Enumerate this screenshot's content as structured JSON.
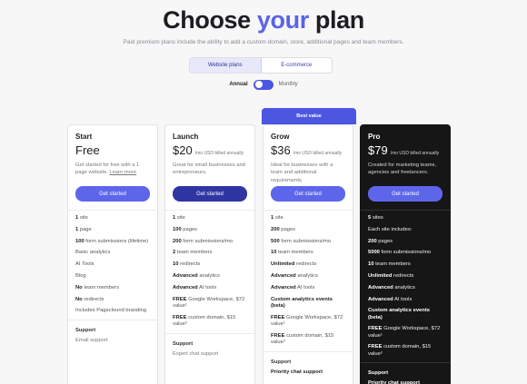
{
  "header": {
    "title_pre": "Choose ",
    "title_accent": "your",
    "title_post": " plan",
    "subtitle": "Paid premium plans include the ability to add a custom domain, store, additional pages and team members."
  },
  "tabs": [
    {
      "label": "Website plans",
      "active": true
    },
    {
      "label": "E-commerce",
      "active": false
    }
  ],
  "billing": {
    "annual_label": "Annual",
    "monthly_label": "Monthly",
    "toggle_on": "annual"
  },
  "best_value_label": "Best value",
  "plans": [
    {
      "name": "Start",
      "price": "Free",
      "price_note": "",
      "desc_text": "Get started for free with a 1 page website.",
      "desc_link": "Learn more",
      "cta": "Get started",
      "features": [
        {
          "b": "1",
          "t": " site"
        },
        {
          "b": "1",
          "t": " page"
        },
        {
          "b": "100",
          "t": " form submissions (lifetime)"
        },
        {
          "b": "",
          "t": "Basic analytics"
        },
        {
          "b": "",
          "t": "AI Tools"
        },
        {
          "b": "",
          "t": "Blog"
        },
        {
          "b": "No",
          "t": " team members"
        },
        {
          "b": "No",
          "t": " redirects"
        },
        {
          "b": "",
          "t": "Includes Pageclound branding"
        }
      ],
      "support_heading": "Support",
      "support_value": "Email support"
    },
    {
      "name": "Launch",
      "price": "$20",
      "price_note": "/mo USD billed annually",
      "desc_text": "Great for small businesses and entrepreneurs.",
      "cta": "Get started",
      "features": [
        {
          "b": "1",
          "t": " site"
        },
        {
          "b": "100",
          "t": " pages"
        },
        {
          "b": "200",
          "t": " form submissions/mo"
        },
        {
          "b": "2",
          "t": " team members"
        },
        {
          "b": "10",
          "t": " redirects"
        },
        {
          "b": "Advanced",
          "t": " analytics"
        },
        {
          "b": "Advanced",
          "t": " AI tools"
        },
        {
          "b": "FREE",
          "t": " Google Workspace, $72 value¹"
        },
        {
          "b": "FREE",
          "t": " custom domain, $15 value²"
        }
      ],
      "support_heading": "Support",
      "support_value": "Expert chat support"
    },
    {
      "name": "Grow",
      "price": "$36",
      "price_note": "/mo USD billed annually",
      "desc_text": "Ideal for businesses with a team and additional requirements.",
      "cta": "Get started",
      "features": [
        {
          "b": "1",
          "t": " site"
        },
        {
          "b": "200",
          "t": " pages"
        },
        {
          "b": "500",
          "t": " form submissions/mo"
        },
        {
          "b": "10",
          "t": " team members"
        },
        {
          "b": "Unlimited",
          "t": " redirects"
        },
        {
          "b": "Advanced",
          "t": " analytics"
        },
        {
          "b": "Advanced",
          "t": " AI tools"
        },
        {
          "b": "Custom analytics events (beta)",
          "t": ""
        },
        {
          "b": "FREE",
          "t": " Google Workspace, $72 value¹"
        },
        {
          "b": "FREE",
          "t": " custom domain, $15 value²"
        }
      ],
      "support_heading": "Support",
      "support_value": "Priority chat support"
    },
    {
      "name": "Pro",
      "price": "$79",
      "price_note": "/mo USD billed annually",
      "desc_text": "Created for marketing teams, agencies and freelancers.",
      "cta": "Get started",
      "features": [
        {
          "b": "5",
          "t": " sites"
        },
        {
          "b": "",
          "t": "Each site includes:"
        },
        {
          "b": "200",
          "t": " pages"
        },
        {
          "b": "5000",
          "t": " form submissions/mo"
        },
        {
          "b": "10",
          "t": " team members"
        },
        {
          "b": "Unlimited",
          "t": " redirects"
        },
        {
          "b": "Advanced",
          "t": " analytics"
        },
        {
          "b": "Advanced",
          "t": " AI tools"
        },
        {
          "b": "Custom analytics events (beta)",
          "t": ""
        },
        {
          "b": "FREE",
          "t": " Google Workspace, $72 value¹"
        },
        {
          "b": "FREE",
          "t": " custom domain, $15 value²"
        }
      ],
      "support_heading": "Support",
      "support_value": "Priority chat support"
    }
  ]
}
